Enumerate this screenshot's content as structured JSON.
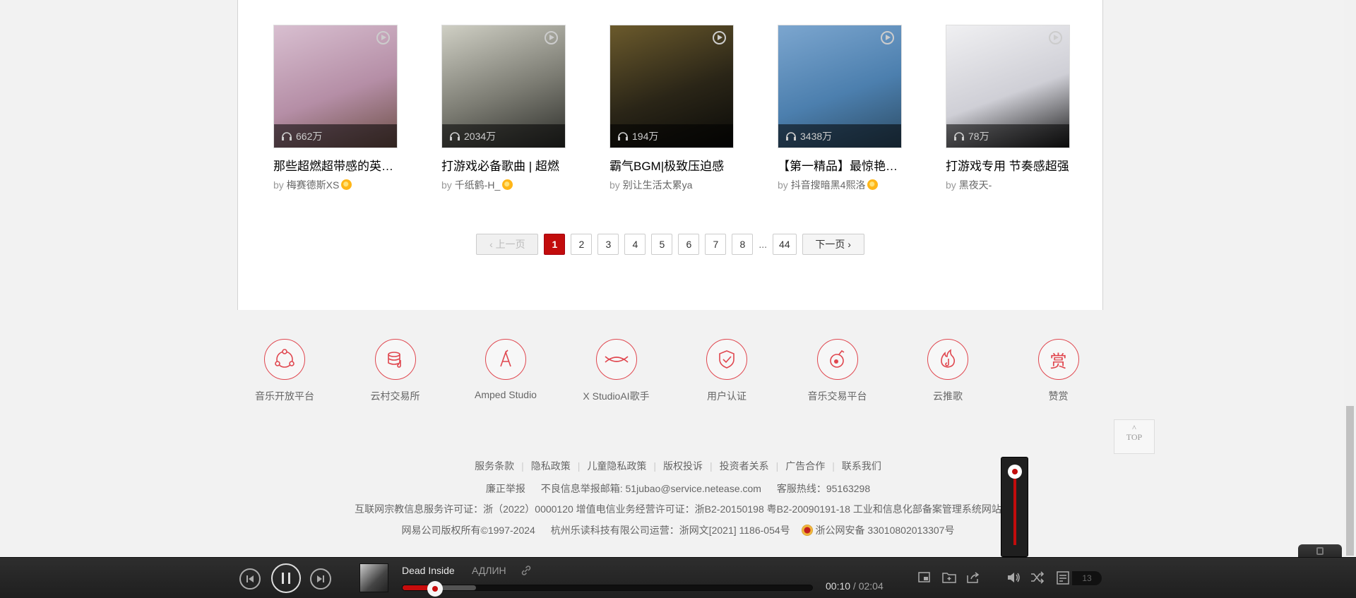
{
  "playlists": [
    {
      "title": "那些超燃超带感的英文歌",
      "play_count": "662万",
      "by": "by",
      "author": "梅赛德斯XS",
      "badge": true,
      "art_colors": [
        "#d8bfd0",
        "#b58ea6",
        "#6e5047"
      ]
    },
    {
      "title": "打游戏必备歌曲 | 超燃",
      "play_count": "2034万",
      "by": "by",
      "author": "千纸鹤-H_",
      "badge": true,
      "art_colors": [
        "#cfcfc4",
        "#7b7b72",
        "#2e2f2b"
      ]
    },
    {
      "title": "霸气BGM|极致压迫感",
      "play_count": "194万",
      "by": "by",
      "author": "别让生活太累ya",
      "badge": false,
      "art_colors": [
        "#6b5a2c",
        "#2a2517",
        "#0a0a08"
      ]
    },
    {
      "title": "【第一精品】最惊艳的歌",
      "play_count": "3438万",
      "by": "by",
      "author": "抖音搜暗黑4熙洛",
      "badge": true,
      "art_colors": [
        "#7ca6cf",
        "#4c7fae",
        "#2d4d66"
      ]
    },
    {
      "title": "打游戏专用 节奏感超强",
      "play_count": "78万",
      "by": "by",
      "author": "黑夜天-",
      "badge": false,
      "art_colors": [
        "#f0f0f2",
        "#cfcfd6",
        "#1a1a1a"
      ]
    }
  ],
  "pagination": {
    "prev": "上一页",
    "next": "下一页",
    "pages": [
      "1",
      "2",
      "3",
      "4",
      "5",
      "6",
      "7",
      "8"
    ],
    "ellipsis": "...",
    "last": "44",
    "current": "1"
  },
  "services": [
    {
      "label": "音乐开放平台",
      "icon": "open-platform-icon"
    },
    {
      "label": "云村交易所",
      "icon": "exchange-icon"
    },
    {
      "label": "Amped Studio",
      "icon": "amped-studio-icon"
    },
    {
      "label": "X StudioAI歌手",
      "icon": "x-studio-icon"
    },
    {
      "label": "用户认证",
      "icon": "verify-shield-icon"
    },
    {
      "label": "音乐交易平台",
      "icon": "music-trade-icon"
    },
    {
      "label": "云推歌",
      "icon": "promote-icon"
    },
    {
      "label": "赞赏",
      "icon": "reward-icon",
      "glyph": "赏"
    }
  ],
  "footer": {
    "links": [
      "服务条款",
      "隐私政策",
      "儿童隐私政策",
      "版权投诉",
      "投资者关系",
      "广告合作",
      "联系我们"
    ],
    "report": "廉正举报",
    "report_email": "不良信息举报邮箱: 51jubao@service.netease.com",
    "hotline": "客服热线：95163298",
    "license": "互联网宗教信息服务许可证：浙（2022）0000120 增值电信业务经营许可证：浙B2-20150198 粤B2-20090191-18  工业和信息化部备案管理系统网站",
    "copyright": "网易公司版权所有©1997-2024",
    "operator": "杭州乐读科技有限公司运营：浙网文[2021] 1186-054号",
    "police": "浙公网安备 33010802013307号"
  },
  "top_button": "TOP",
  "player": {
    "song": "Dead Inside",
    "artist": "АДЛИН",
    "current_time": "00:10",
    "total_time": "02:04",
    "progress_fraction": 0.08,
    "buffered_fraction": 0.18,
    "playlist_count": "13",
    "volume_fraction": 1.0,
    "accent": "#c20c0c"
  }
}
